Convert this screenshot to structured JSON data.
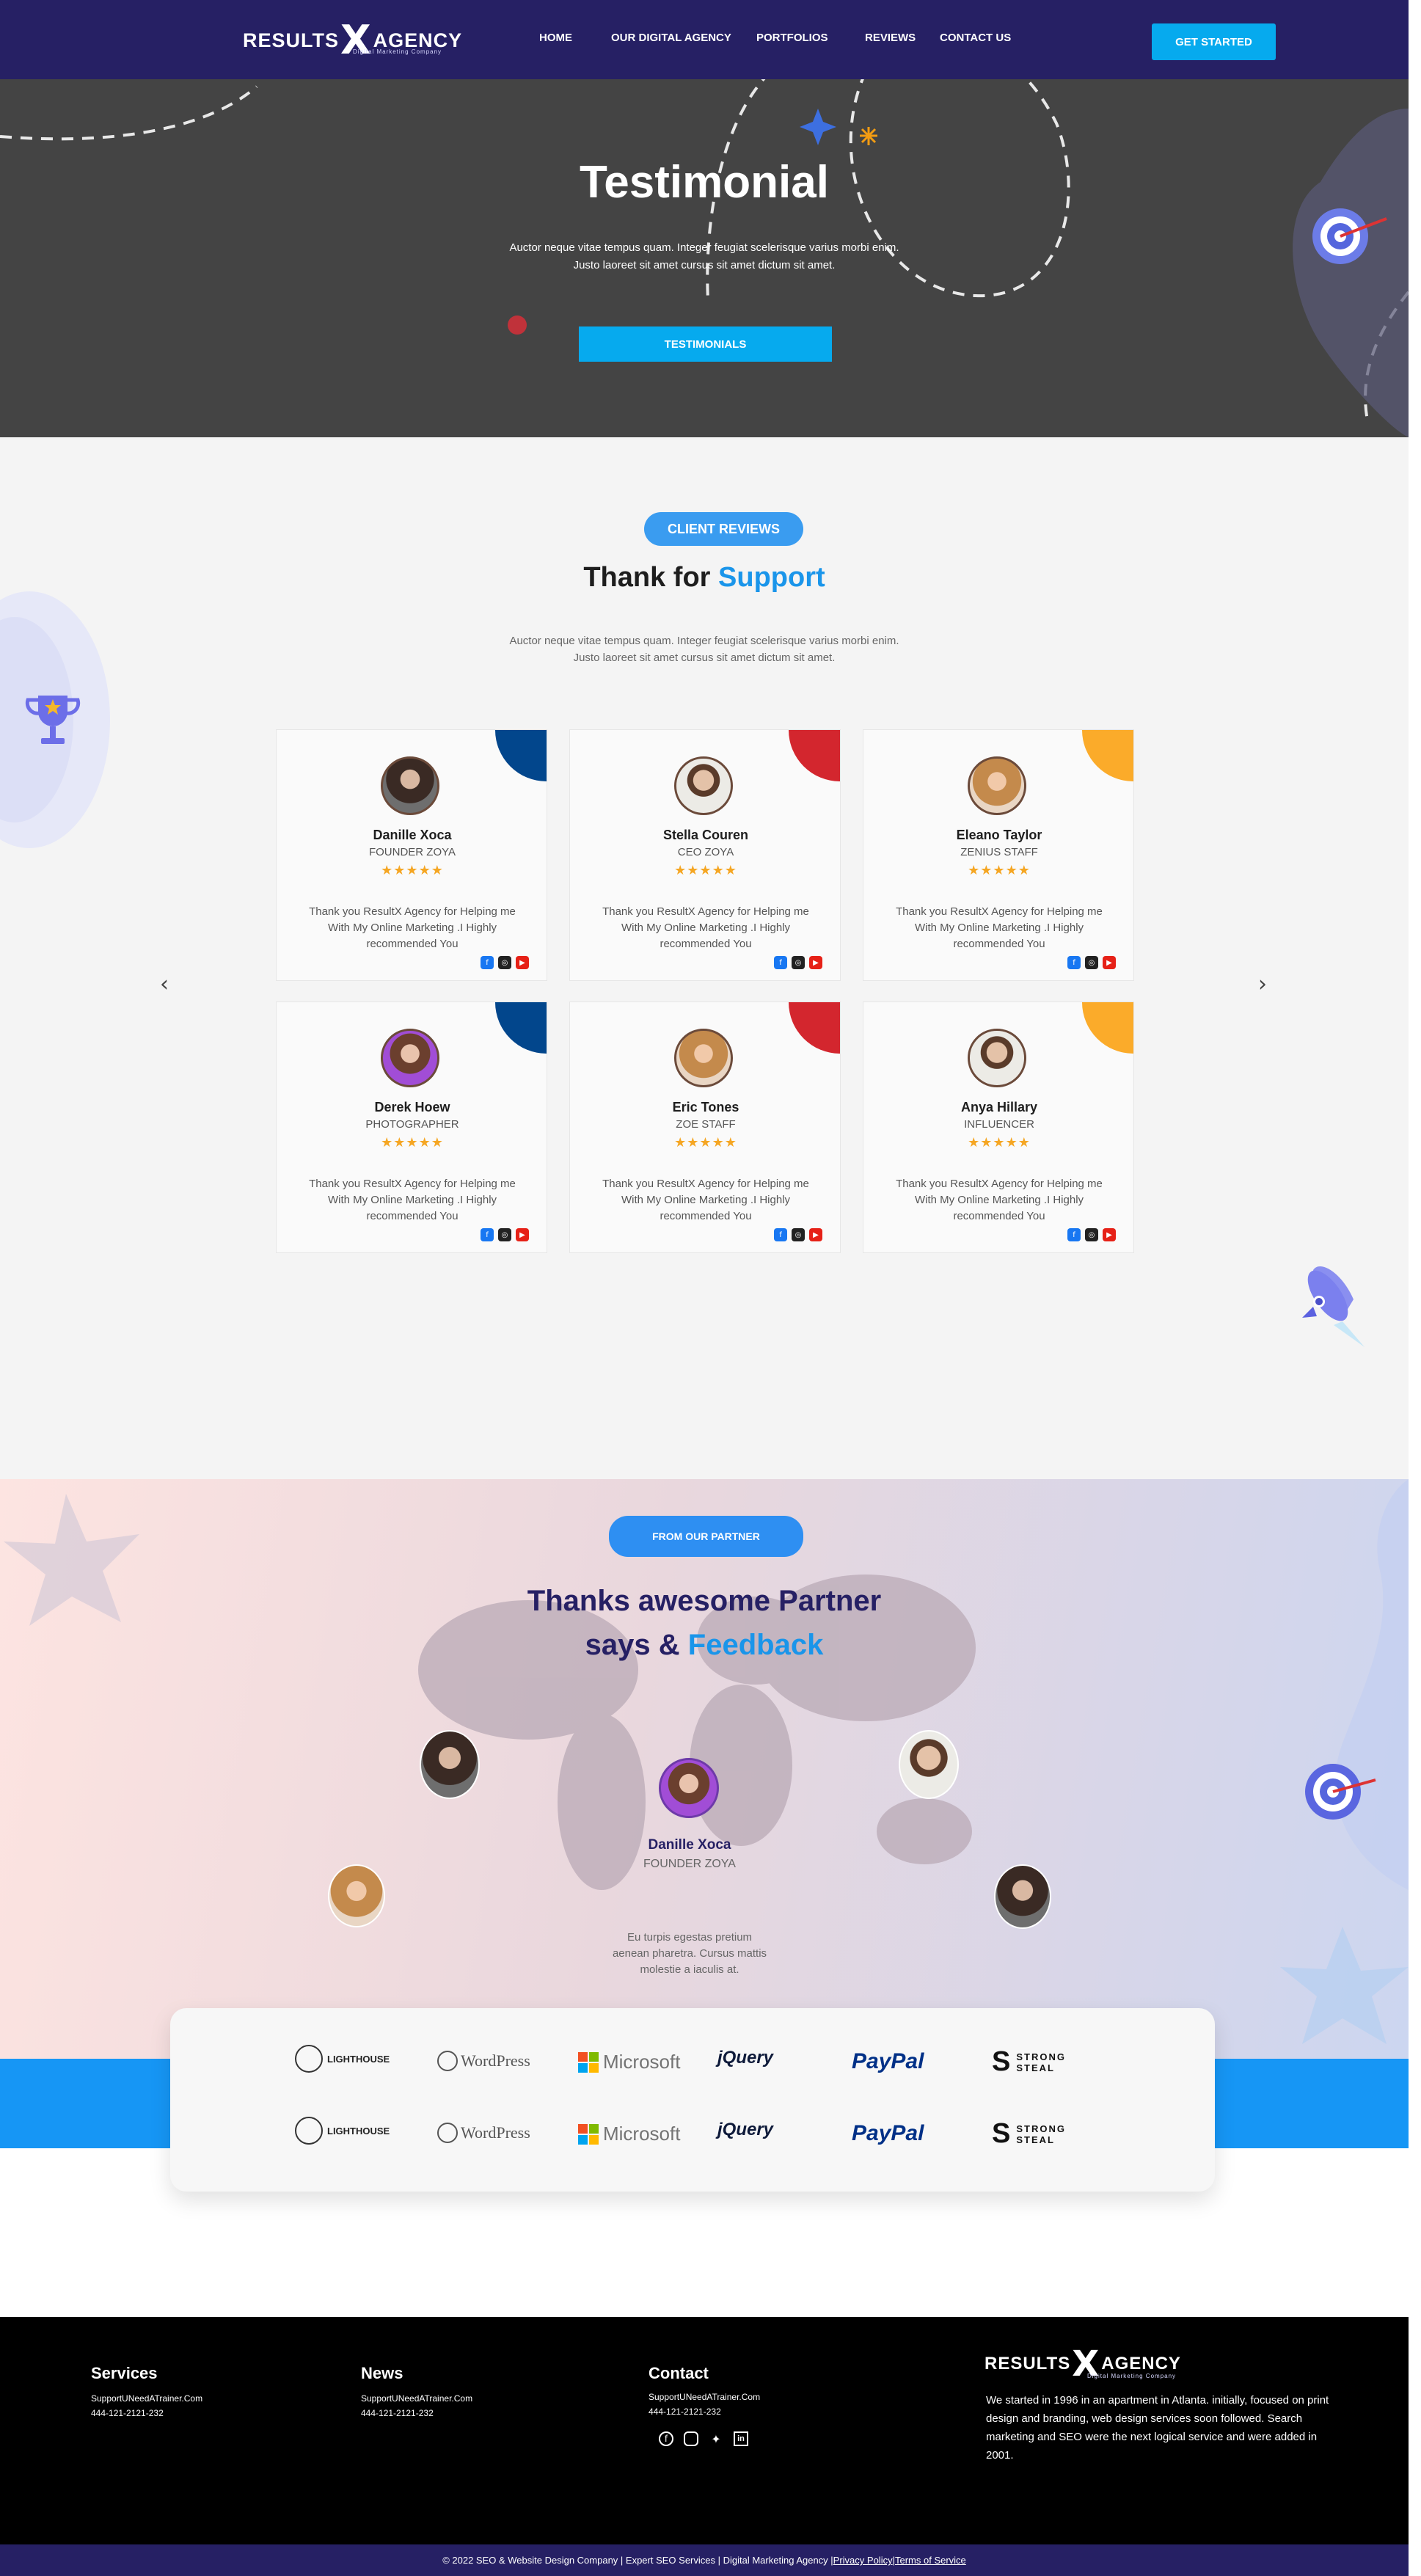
{
  "nav": {
    "logo_left": "RESULTS",
    "logo_x": "X",
    "logo_right": "AGENCY",
    "logo_tagline": "Digital Marketing Company",
    "links": [
      "HOME",
      "OUR DIGITAL AGENCY",
      "PORTFOLIOS",
      "REVIEWS",
      "CONTACT US"
    ],
    "cta": "GET STARTED"
  },
  "hero": {
    "title": "Testimonial",
    "desc_line1": "Auctor neque vitae tempus quam. Integer feugiat scelerisque varius morbi enim.",
    "desc_line2": "Justo laoreet sit amet cursus sit amet dictum sit amet.",
    "button": "TESTIMONIALS"
  },
  "reviews": {
    "badge": "CLIENT REVIEWS",
    "title_plain": "Thank for ",
    "title_accent": "Support",
    "desc_line1": "Auctor neque vitae tempus quam. Integer feugiat scelerisque varius morbi enim.",
    "desc_line2": "Justo laoreet sit amet cursus sit amet dictum sit amet.",
    "stars": "★★★★★",
    "cards": [
      {
        "name": "Danille Xoca",
        "role": "FOUNDER ZOYA",
        "text": "Thank you ResultX Agency for Helping me With My Online Marketing .I Highly recommended You",
        "corner": "#02468c"
      },
      {
        "name": "Stella Couren",
        "role": "CEO ZOYA",
        "text": "Thank you ResultX Agency for Helping me With My Online Marketing .I Highly recommended You",
        "corner": "#d3262e"
      },
      {
        "name": "Eleano Taylor",
        "role": "ZENIUS STAFF",
        "text": "Thank you ResultX Agency for Helping me With My Online Marketing .I Highly recommended You",
        "corner": "#fbab2a"
      },
      {
        "name": "Derek Hoew",
        "role": "PHOTOGRAPHER",
        "text": "Thank you ResultX Agency for Helping me With My Online Marketing .I Highly recommended You",
        "corner": "#02468c"
      },
      {
        "name": "Eric Tones",
        "role": "ZOE STAFF",
        "text": "Thank you ResultX Agency for Helping me With My Online Marketing .I Highly recommended You",
        "corner": "#d3262e"
      },
      {
        "name": "Anya Hillary",
        "role": "INFLUENCER",
        "text": "Thank you ResultX Agency for Helping me With My Online Marketing .I Highly recommended You",
        "corner": "#fbab2a"
      }
    ],
    "arrow_prev": "‹",
    "arrow_next": "›"
  },
  "partner": {
    "badge": "FROM OUR PARTNER",
    "title_line1": "Thanks awesome Partner",
    "title_line2_plain": "says & ",
    "title_line2_accent": "Feedback",
    "featured_name": "Danille Xoca",
    "featured_role": "FOUNDER ZOYA",
    "quote_line1": "Eu turpis egestas pretium",
    "quote_line2": "aenean pharetra. Cursus mattis",
    "quote_line3": "molestie a iaculis at."
  },
  "brands": {
    "lighthouse": "LIGHTHOUSE",
    "wordpress": "WordPress",
    "microsoft": "Microsoft",
    "jquery": "jQuery",
    "paypal": "PayPal",
    "strong1": "STRONG",
    "strong2": "STEAL"
  },
  "footer": {
    "services_title": "Services",
    "news_title": "News",
    "contact_title": "Contact",
    "email": "SupportUNeedATrainer.Com",
    "phone": "444-121-2121-232",
    "about": "We started in 1996 in an apartment in Atlanta. initially, focused on print design and branding, web design services soon followed. Search marketing and SEO were the next logical service and were added in 2001.",
    "copyright": "© 2022 SEO & Website Design Company | Expert SEO Services | Digital Marketing Agency | ",
    "privacy": "Privacy Policy",
    "sep": " | ",
    "terms": "Terms of Service"
  }
}
